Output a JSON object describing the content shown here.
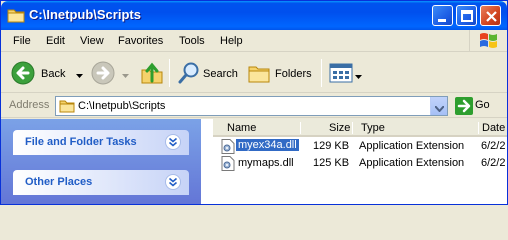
{
  "window": {
    "title": "C:\\Inetpub\\Scripts"
  },
  "menu": {
    "items": [
      "File",
      "Edit",
      "View",
      "Favorites",
      "Tools",
      "Help"
    ]
  },
  "toolbar": {
    "back_label": "Back",
    "search_label": "Search",
    "folders_label": "Folders"
  },
  "address": {
    "label": "Address",
    "value": "C:\\Inetpub\\Scripts",
    "go_label": "Go"
  },
  "taskpane": {
    "sections": [
      {
        "title": "File and Folder Tasks"
      },
      {
        "title": "Other Places"
      }
    ]
  },
  "filelist": {
    "columns": [
      "Name",
      "Size",
      "Type",
      "Date"
    ],
    "rows": [
      {
        "name": "myex34a.dll",
        "size": "129 KB",
        "type": "Application Extension",
        "date": "6/2/2",
        "selected": true
      },
      {
        "name": "mymaps.dll",
        "size": "125 KB",
        "type": "Application Extension",
        "date": "6/2/2",
        "selected": false
      }
    ]
  },
  "colors": {
    "titlebar": "#0055EB",
    "selection": "#316AC5",
    "taskpane": "#7BA2E7",
    "tasktitle": "#215DC6"
  }
}
